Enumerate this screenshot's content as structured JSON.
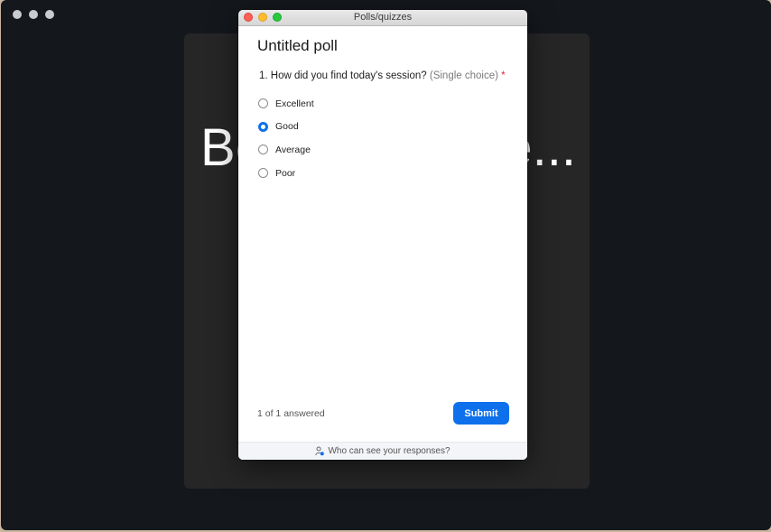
{
  "background": {
    "stage_text_left": "Be",
    "stage_text_right": "e..."
  },
  "poll_window": {
    "title": "Polls/quizzes",
    "poll_title": "Untitled poll",
    "question": {
      "number_text": "1. How did you find today's session?",
      "type": "(Single choice)",
      "required_marker": "*"
    },
    "options": [
      {
        "label": "Excellent",
        "selected": false
      },
      {
        "label": "Good",
        "selected": true
      },
      {
        "label": "Average",
        "selected": false
      },
      {
        "label": "Poor",
        "selected": false
      }
    ],
    "answered_status": "1 of 1 answered",
    "submit_label": "Submit",
    "footer_link": "Who can see your responses?"
  },
  "colors": {
    "accent": "#0e71eb",
    "required": "#e5243b"
  },
  "icons": {
    "footer": "person-visibility-icon"
  }
}
